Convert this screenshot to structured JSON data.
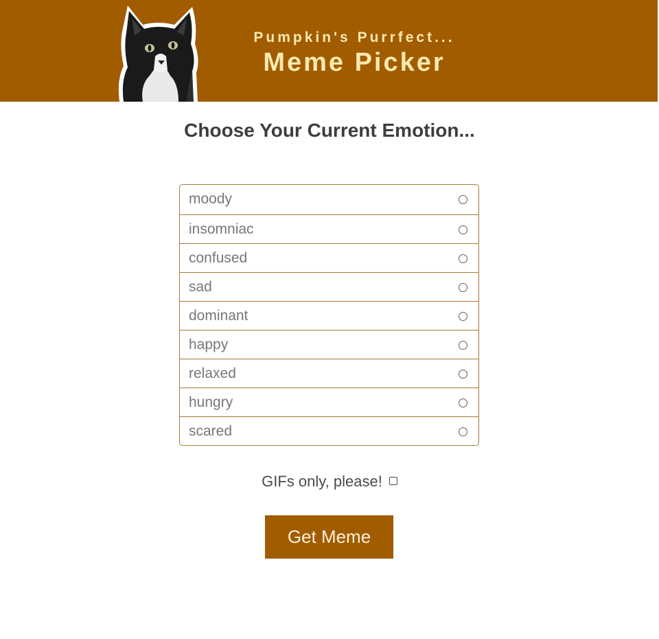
{
  "header": {
    "subtitle": "Pumpkin's Purrfect...",
    "title": "Meme Picker",
    "background_color": "#a15c00",
    "text_color": "#fbe9b0",
    "logo_icon": "cat-photo"
  },
  "main": {
    "question": "Choose Your Current Emotion...",
    "emotions": [
      {
        "label": "moody",
        "selected": false
      },
      {
        "label": "insomniac",
        "selected": false
      },
      {
        "label": "confused",
        "selected": false
      },
      {
        "label": "sad",
        "selected": false
      },
      {
        "label": "dominant",
        "selected": false
      },
      {
        "label": "happy",
        "selected": false
      },
      {
        "label": "relaxed",
        "selected": false
      },
      {
        "label": "hungry",
        "selected": false
      },
      {
        "label": "scared",
        "selected": false
      }
    ],
    "gifs_only_label": "GIFs only, please!",
    "gifs_only_checked": false,
    "get_button_label": "Get Meme",
    "border_color": "#a67a36"
  }
}
